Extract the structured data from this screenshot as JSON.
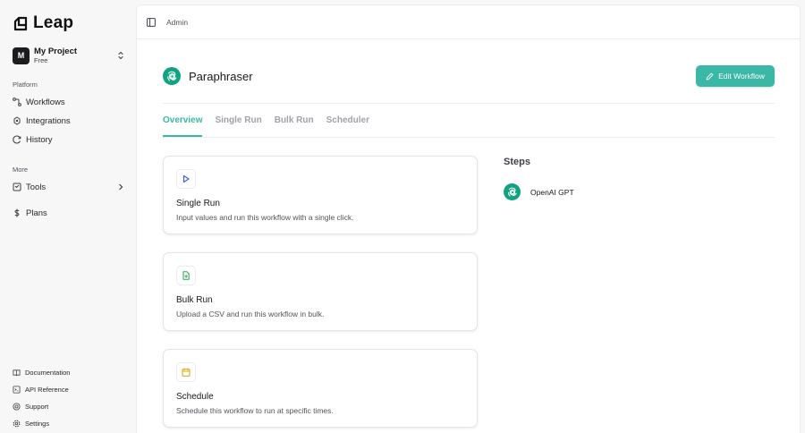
{
  "app": {
    "name": "Leap"
  },
  "project": {
    "avatar_letter": "M",
    "name": "My Project",
    "plan": "Free"
  },
  "sidebar": {
    "platform_label": "Platform",
    "platform_items": [
      {
        "label": "Workflows",
        "icon": "workflow-icon"
      },
      {
        "label": "Integrations",
        "icon": "integrations-icon"
      },
      {
        "label": "History",
        "icon": "history-icon"
      }
    ],
    "more_label": "More",
    "more_items": [
      {
        "label": "Tools",
        "icon": "tools-icon"
      },
      {
        "label": "Plans",
        "icon": "dollar-icon"
      }
    ],
    "footer_items": [
      {
        "label": "Documentation",
        "icon": "book-icon"
      },
      {
        "label": "API Reference",
        "icon": "terminal-icon"
      },
      {
        "label": "Support",
        "icon": "lifebuoy-icon"
      },
      {
        "label": "Settings",
        "icon": "gear-icon"
      }
    ]
  },
  "breadcrumb": "Admin",
  "workflow": {
    "title": "Paraphraser",
    "icon": "openai-icon",
    "edit_label": "Edit Workflow"
  },
  "tabs": [
    {
      "label": "Overview",
      "active": true
    },
    {
      "label": "Single Run",
      "active": false
    },
    {
      "label": "Bulk Run",
      "active": false
    },
    {
      "label": "Scheduler",
      "active": false
    }
  ],
  "cards": [
    {
      "title": "Single Run",
      "desc": "Input values and run this workflow with a single click.",
      "icon": "play-icon",
      "color": "#3b5bdb"
    },
    {
      "title": "Bulk Run",
      "desc": "Upload a CSV and run this workflow in bulk.",
      "icon": "file-plus-icon",
      "color": "#22a55a"
    },
    {
      "title": "Schedule",
      "desc": "Schedule this workflow to run at specific times.",
      "icon": "calendar-icon",
      "color": "#e0a100"
    }
  ],
  "steps": {
    "title": "Steps",
    "items": [
      {
        "label": "OpenAI GPT",
        "icon": "openai-icon"
      }
    ]
  },
  "colors": {
    "accent": "#3ab7a7",
    "openai": "#10a37f"
  }
}
